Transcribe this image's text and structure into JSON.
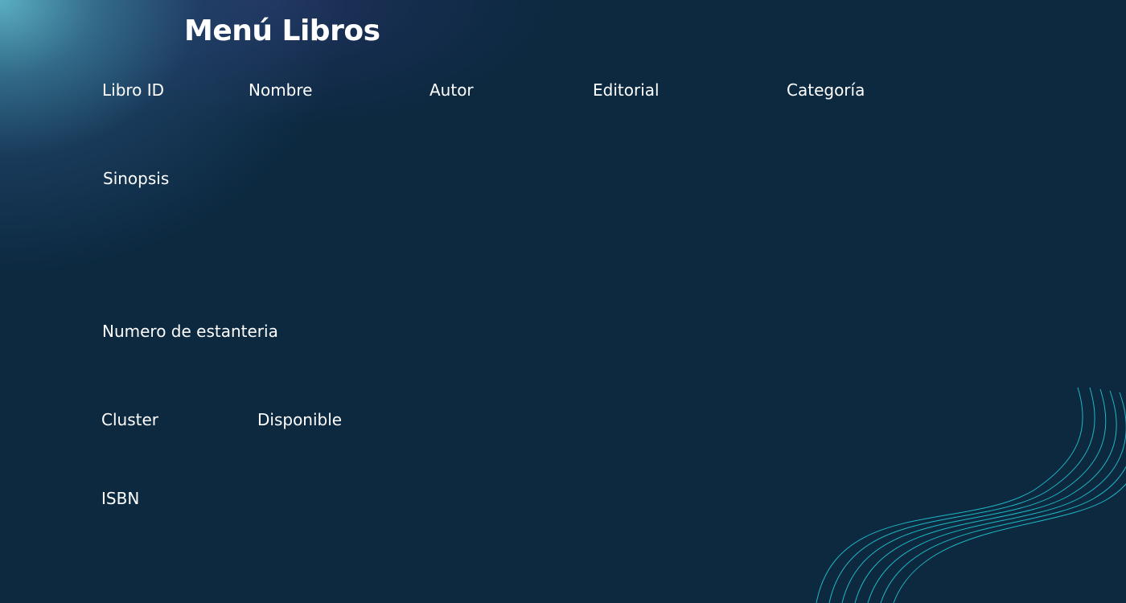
{
  "page": {
    "title": "Menú Libros"
  },
  "form": {
    "fields": {
      "libro_id": "Libro ID",
      "nombre": "Nombre",
      "autor": "Autor",
      "editorial": "Editorial",
      "categoria": "Categoría",
      "sinopsis": "Sinopsis",
      "numero_estanteria": "Numero de estanteria",
      "cluster": "Cluster",
      "disponible": "Disponible",
      "isbn": "ISBN"
    }
  },
  "theme": {
    "background": "#0c2940",
    "glow": "#5fb6c8",
    "wave_lines": "#1fb8c4",
    "text": "#ffffff"
  }
}
